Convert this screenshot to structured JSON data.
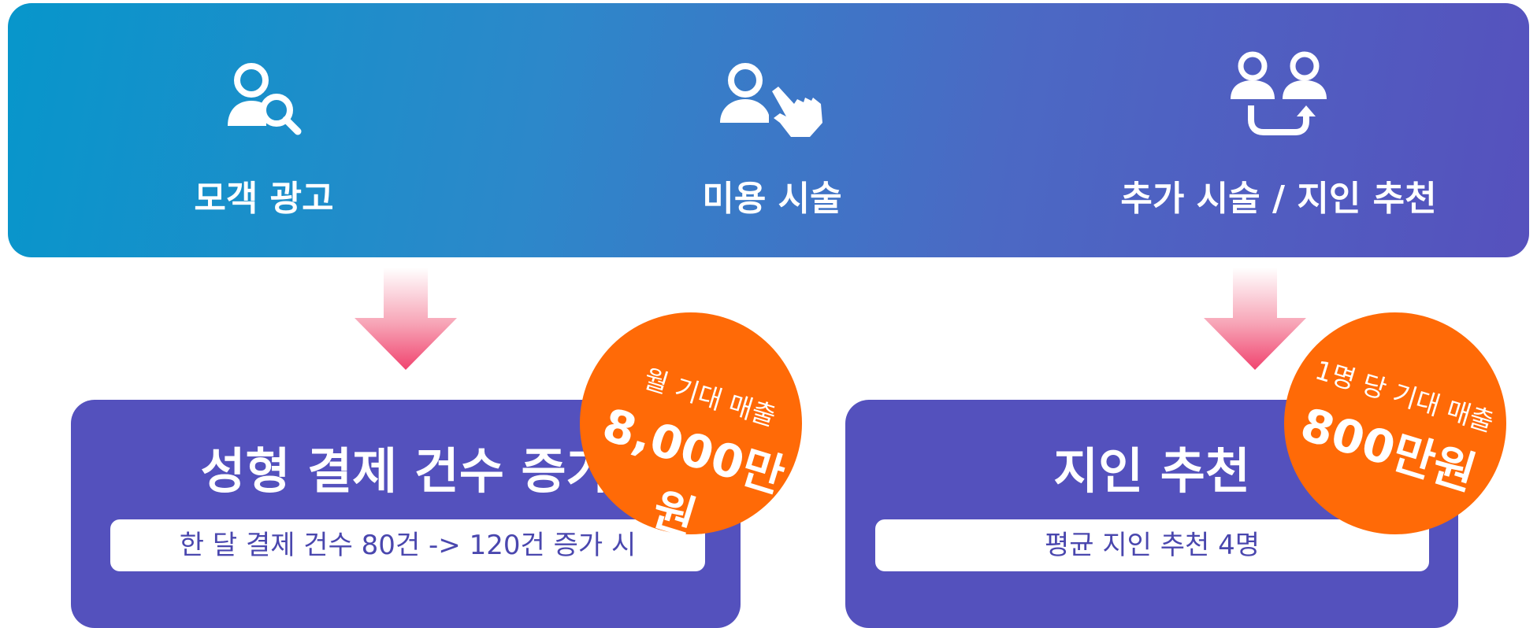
{
  "steps": [
    {
      "label": "모객 광고",
      "icon": "person-search-icon"
    },
    {
      "label": "미용 시술",
      "icon": "person-pointing-hand-icon"
    },
    {
      "label": "추가 시술 / 지인 추천",
      "icon": "people-referral-icon"
    }
  ],
  "cards": [
    {
      "title": "성형 결제 건수 증가",
      "detail": "한 달 결제 건수 80건 -> 120건 증가 시",
      "badge": {
        "small": "월 기대 매출",
        "big": "8,000만원"
      }
    },
    {
      "title": "지인 추천",
      "detail": "평균 지인 추천 4명",
      "badge": {
        "small": "1명 당 기대 매출",
        "big": "800만원"
      }
    }
  ],
  "colors": {
    "banner_start": "#0796cb",
    "banner_end": "#5651bd",
    "card": "#5451bd",
    "badge": "#ff6a07",
    "arrow": "#f0446f"
  }
}
